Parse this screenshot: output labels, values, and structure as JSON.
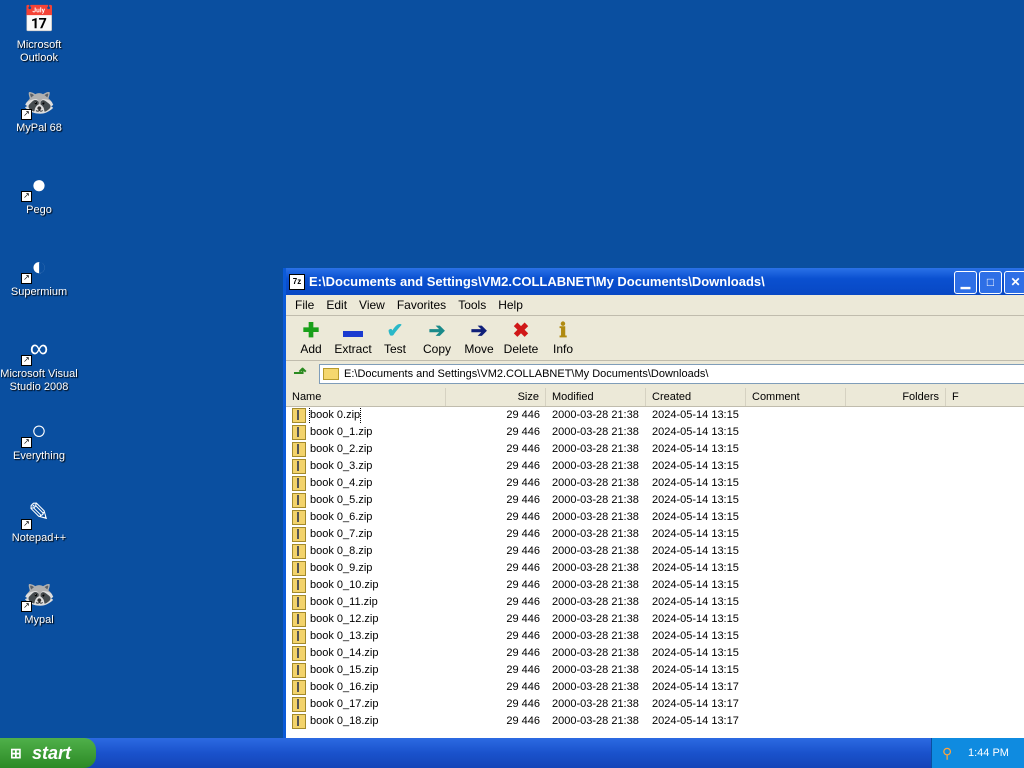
{
  "desktop_icons": [
    {
      "label1": "Microsoft",
      "label2": "Outlook",
      "icon": "outlook-icon",
      "glyph": "📅"
    },
    {
      "label1": "MyPal 68",
      "label2": "",
      "icon": "raccoon-icon",
      "glyph": "🦝"
    },
    {
      "label1": "Pego",
      "label2": "",
      "icon": "pego-icon",
      "glyph": "●"
    },
    {
      "label1": "Supermium",
      "label2": "",
      "icon": "supermium-icon",
      "glyph": "◐"
    },
    {
      "label1": "Microsoft Visual",
      "label2": "Studio 2008",
      "icon": "visual-studio-icon",
      "glyph": "∞"
    },
    {
      "label1": "Everything",
      "label2": "",
      "icon": "everything-icon",
      "glyph": "○"
    },
    {
      "label1": "Notepad++",
      "label2": "",
      "icon": "notepadpp-icon",
      "glyph": "✎"
    },
    {
      "label1": "Mypal",
      "label2": "",
      "icon": "raccoon-icon",
      "glyph": "🦝"
    }
  ],
  "window": {
    "app_icon": "7z",
    "title": "E:\\Documents and Settings\\VM2.COLLABNET\\My Documents\\Downloads\\",
    "menu": [
      "File",
      "Edit",
      "View",
      "Favorites",
      "Tools",
      "Help"
    ],
    "toolbar": [
      {
        "label": "Add",
        "glyph": "✚",
        "color": "#1aa01a"
      },
      {
        "label": "Extract",
        "glyph": "▬",
        "color": "#1a3ad0"
      },
      {
        "label": "Test",
        "glyph": "✔",
        "color": "#2ab8c8"
      },
      {
        "label": "Copy",
        "glyph": "➔",
        "color": "#1a8a8a"
      },
      {
        "label": "Move",
        "glyph": "➔",
        "color": "#10207a"
      },
      {
        "label": "Delete",
        "glyph": "✖",
        "color": "#d01818"
      },
      {
        "label": "Info",
        "glyph": "ℹ",
        "color": "#b08a10"
      }
    ],
    "address": "E:\\Documents and Settings\\VM2.COLLABNET\\My Documents\\Downloads\\",
    "columns": [
      "Name",
      "Size",
      "Modified",
      "Created",
      "Comment",
      "Folders",
      "F"
    ],
    "files": [
      {
        "name": "book 0.zip",
        "size": "29 446",
        "modified": "2000-03-28 21:38",
        "created": "2024-05-14 13:15"
      },
      {
        "name": "book 0_1.zip",
        "size": "29 446",
        "modified": "2000-03-28 21:38",
        "created": "2024-05-14 13:15"
      },
      {
        "name": "book 0_2.zip",
        "size": "29 446",
        "modified": "2000-03-28 21:38",
        "created": "2024-05-14 13:15"
      },
      {
        "name": "book 0_3.zip",
        "size": "29 446",
        "modified": "2000-03-28 21:38",
        "created": "2024-05-14 13:15"
      },
      {
        "name": "book 0_4.zip",
        "size": "29 446",
        "modified": "2000-03-28 21:38",
        "created": "2024-05-14 13:15"
      },
      {
        "name": "book 0_5.zip",
        "size": "29 446",
        "modified": "2000-03-28 21:38",
        "created": "2024-05-14 13:15"
      },
      {
        "name": "book 0_6.zip",
        "size": "29 446",
        "modified": "2000-03-28 21:38",
        "created": "2024-05-14 13:15"
      },
      {
        "name": "book 0_7.zip",
        "size": "29 446",
        "modified": "2000-03-28 21:38",
        "created": "2024-05-14 13:15"
      },
      {
        "name": "book 0_8.zip",
        "size": "29 446",
        "modified": "2000-03-28 21:38",
        "created": "2024-05-14 13:15"
      },
      {
        "name": "book 0_9.zip",
        "size": "29 446",
        "modified": "2000-03-28 21:38",
        "created": "2024-05-14 13:15"
      },
      {
        "name": "book 0_10.zip",
        "size": "29 446",
        "modified": "2000-03-28 21:38",
        "created": "2024-05-14 13:15"
      },
      {
        "name": "book 0_11.zip",
        "size": "29 446",
        "modified": "2000-03-28 21:38",
        "created": "2024-05-14 13:15"
      },
      {
        "name": "book 0_12.zip",
        "size": "29 446",
        "modified": "2000-03-28 21:38",
        "created": "2024-05-14 13:15"
      },
      {
        "name": "book 0_13.zip",
        "size": "29 446",
        "modified": "2000-03-28 21:38",
        "created": "2024-05-14 13:15"
      },
      {
        "name": "book 0_14.zip",
        "size": "29 446",
        "modified": "2000-03-28 21:38",
        "created": "2024-05-14 13:15"
      },
      {
        "name": "book 0_15.zip",
        "size": "29 446",
        "modified": "2000-03-28 21:38",
        "created": "2024-05-14 13:15"
      },
      {
        "name": "book 0_16.zip",
        "size": "29 446",
        "modified": "2000-03-28 21:38",
        "created": "2024-05-14 13:17"
      },
      {
        "name": "book 0_17.zip",
        "size": "29 446",
        "modified": "2000-03-28 21:38",
        "created": "2024-05-14 13:17"
      },
      {
        "name": "book 0_18.zip",
        "size": "29 446",
        "modified": "2000-03-28 21:38",
        "created": "2024-05-14 13:17"
      }
    ]
  },
  "taskbar": {
    "start_label": "start",
    "clock": "1:44 PM"
  }
}
